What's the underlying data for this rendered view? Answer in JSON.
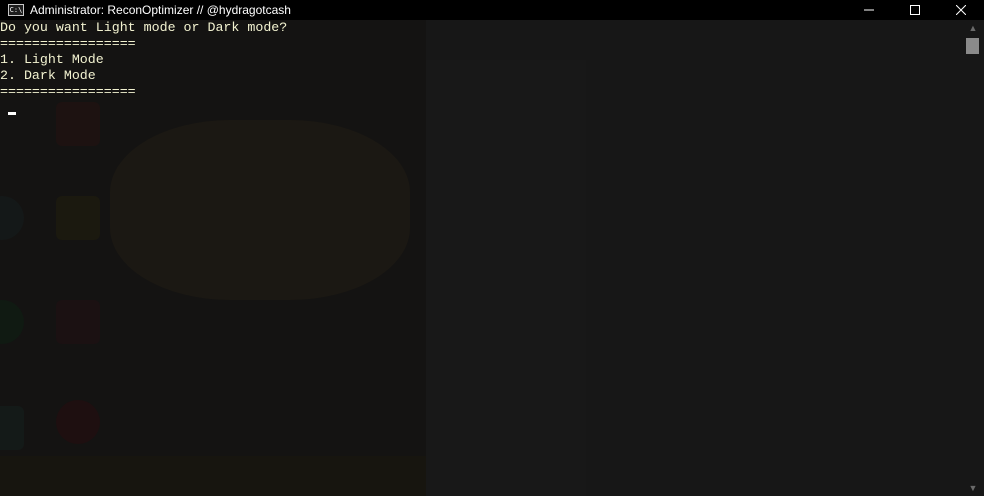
{
  "window": {
    "title": "Administrator:  ReconOptimizer // @hydragotcash",
    "icon": "cmd-icon",
    "controls": [
      "minimize",
      "maximize",
      "close"
    ]
  },
  "console": {
    "lines": [
      "Do you want Light mode or Dark mode?",
      "=================",
      "1. Light Mode",
      "2. Dark Mode",
      "================="
    ],
    "text_color": "#f2f2d0",
    "background_color": "#0c0c0c"
  }
}
